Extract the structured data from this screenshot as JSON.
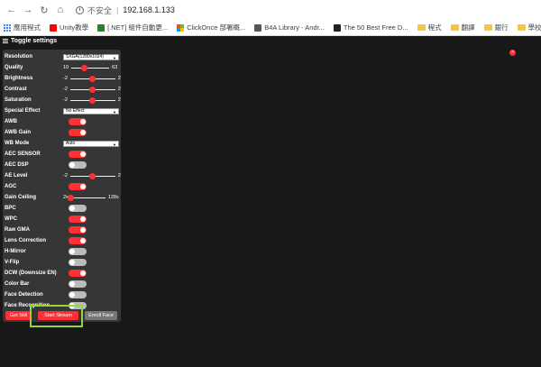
{
  "browser": {
    "security_label": "不安全",
    "separator": "|",
    "host": "192.168.1.133",
    "bookmarks": [
      {
        "label": "應用程式",
        "icon": "apps-grid-icon"
      },
      {
        "label": "Unity教學",
        "icon": "youtube-icon"
      },
      {
        "label": "[.NET] 組件自動更...",
        "icon": "site-icon"
      },
      {
        "label": "ClickOnce 部署概...",
        "icon": "microsoft-icon"
      },
      {
        "label": "B4A Library - Andr...",
        "icon": "site-icon"
      },
      {
        "label": "The 50 Best Free D...",
        "icon": "site-icon"
      },
      {
        "label": "程式",
        "icon": "folder-icon"
      },
      {
        "label": "翻譯",
        "icon": "folder-icon"
      },
      {
        "label": "銀行",
        "icon": "folder-icon"
      },
      {
        "label": "學校",
        "icon": "folder-icon"
      }
    ]
  },
  "app": {
    "menu_label": "Toggle settings",
    "accent_color": "#ff3034",
    "settings": {
      "resolution": {
        "label": "Resolution",
        "value": "SXGA(1280x1024)"
      },
      "quality": {
        "label": "Quality",
        "min": "10",
        "max": "63",
        "value": 0.34
      },
      "brightness": {
        "label": "Brightness",
        "min": "-2",
        "max": "2",
        "value": 0.5
      },
      "contrast": {
        "label": "Contrast",
        "min": "-2",
        "max": "2",
        "value": 0.5
      },
      "saturation": {
        "label": "Saturation",
        "min": "-2",
        "max": "2",
        "value": 0.5
      },
      "special_effect": {
        "label": "Special Effect",
        "value": "No Effect"
      },
      "awb": {
        "label": "AWB",
        "on": true
      },
      "awb_gain": {
        "label": "AWB Gain",
        "on": true
      },
      "wb_mode": {
        "label": "WB Mode",
        "value": "Auto"
      },
      "aec_sensor": {
        "label": "AEC SENSOR",
        "on": true
      },
      "aec_dsp": {
        "label": "AEC DSP",
        "on": false
      },
      "ae_level": {
        "label": "AE Level",
        "min": "-2",
        "max": "2",
        "value": 0.5
      },
      "agc": {
        "label": "AGC",
        "on": true
      },
      "gain_ceiling": {
        "label": "Gain Ceiling",
        "min": "2x",
        "max": "128x",
        "value": 0.0
      },
      "bpc": {
        "label": "BPC",
        "on": false
      },
      "wpc": {
        "label": "WPC",
        "on": true
      },
      "raw_gma": {
        "label": "Raw GMA",
        "on": true
      },
      "lens_correction": {
        "label": "Lens Correction",
        "on": true
      },
      "h_mirror": {
        "label": "H-Mirror",
        "on": false
      },
      "v_flip": {
        "label": "V-Flip",
        "on": false
      },
      "dcw": {
        "label": "DCW (Downsize EN)",
        "on": true
      },
      "color_bar": {
        "label": "Color Bar",
        "on": false
      },
      "face_detection": {
        "label": "Face Detection",
        "on": false
      },
      "face_recognition": {
        "label": "Face Recognition",
        "on": false
      }
    },
    "buttons": {
      "get_still": "Get Still",
      "start_stream": "Start Stream",
      "enroll_face": "Enroll Face"
    },
    "stream_close_glyph": "×"
  }
}
